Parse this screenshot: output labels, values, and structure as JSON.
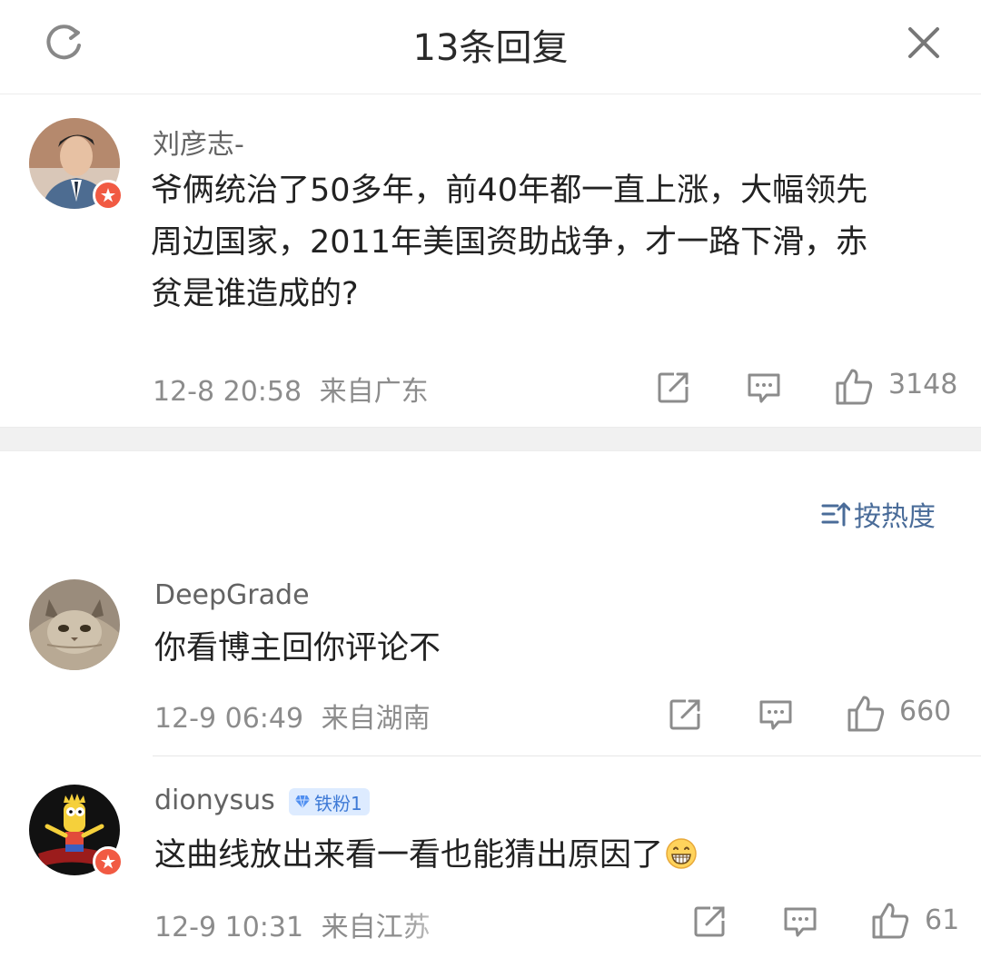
{
  "header": {
    "title": "13条回复",
    "refresh_icon": "refresh-icon",
    "close_icon": "close-icon"
  },
  "root_comment": {
    "username": "刘彦志-",
    "text_lines": [
      "爷俩统治了50多年，前40年都一直上涨，大幅领先",
      "周边国家，2011年美国资助战争，才一路下滑，赤",
      "贫是谁造成的?"
    ],
    "time": "12-8 20:58",
    "location": "来自广东",
    "likes": "3148"
  },
  "sort": {
    "label": "按热度",
    "icon": "sort-icon"
  },
  "replies": [
    {
      "username": "DeepGrade",
      "text": "你看博主回你评论不",
      "time": "12-9 06:49",
      "location": "来自湖南",
      "likes": "660"
    },
    {
      "username": "dionysus",
      "badge": "铁粉1",
      "text": "这曲线放出来看一看也能猜出原因了",
      "emoji": "grin-emoji",
      "time": "12-9 10:31",
      "location": "来自江苏",
      "likes": "61"
    }
  ],
  "colors": {
    "link": "#4a6c99",
    "meta": "#8c8c8c",
    "badge_bg": "#ddebff",
    "badge_text": "#3e7ad6",
    "verified": "#f15a43"
  }
}
